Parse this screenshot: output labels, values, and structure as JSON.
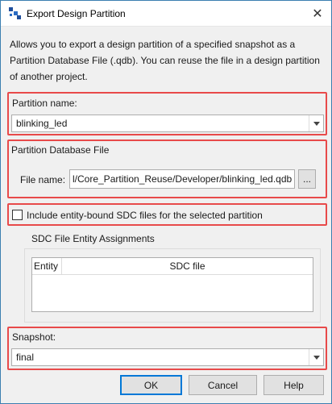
{
  "window": {
    "title": "Export Design Partition",
    "close_glyph": "✕"
  },
  "description": "Allows you to export a design partition of a specified snapshot as a Partition Database File (.qdb). You can reuse the file in a design partition of another project.",
  "partition": {
    "label": "Partition name:",
    "value": "blinking_led"
  },
  "database_file": {
    "group_title": "Partition Database File",
    "file_label": "File name:",
    "file_value": "l/Core_Partition_Reuse/Developer/blinking_led.qdb",
    "browse_label": "..."
  },
  "include_sdc": {
    "label": "Include entity-bound SDC files for the selected partition",
    "checked": false
  },
  "sdc_assignments": {
    "title": "SDC File Entity Assignments",
    "columns": [
      "Entity",
      "SDC file"
    ]
  },
  "snapshot": {
    "label": "Snapshot:",
    "value": "final"
  },
  "buttons": {
    "ok": "OK",
    "cancel": "Cancel",
    "help": "Help"
  },
  "colors": {
    "highlight": "#e84a4a",
    "accent": "#0078d7"
  }
}
